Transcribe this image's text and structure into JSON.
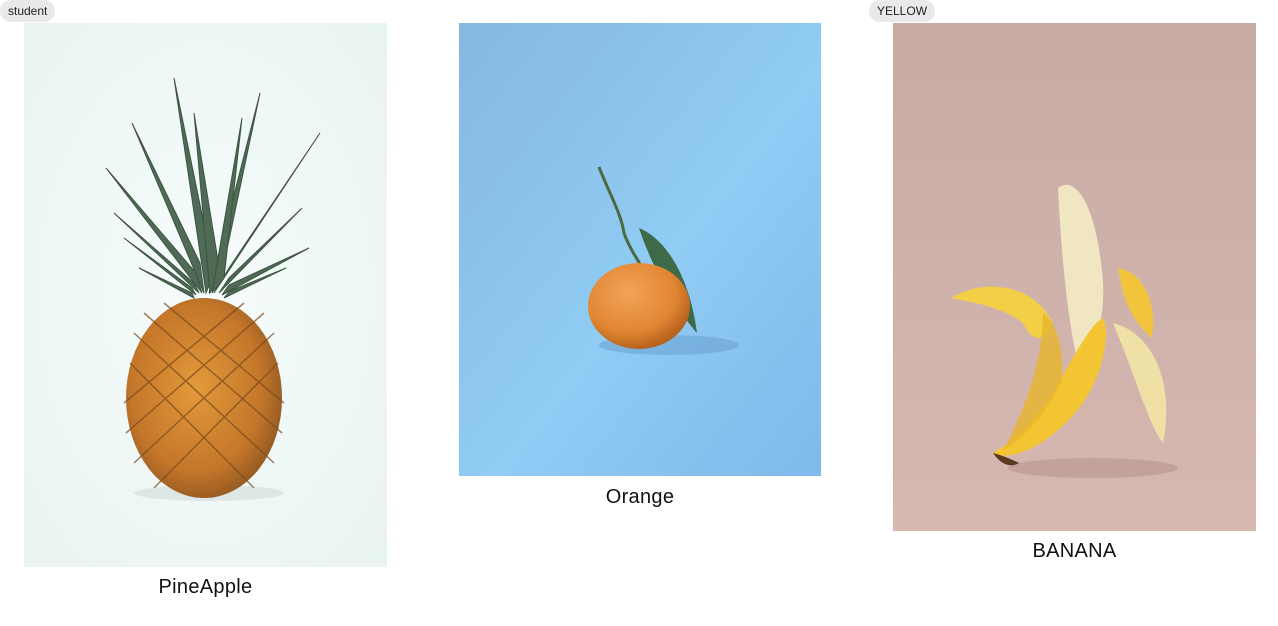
{
  "cards": [
    {
      "tag": "student",
      "caption": "PineApple"
    },
    {
      "tag": "",
      "caption": "Orange"
    },
    {
      "tag": "YELLOW",
      "caption": "BANANA"
    }
  ],
  "colors": {
    "pineapple_bg": "#eef8f6",
    "orange_bg": "#8cc4ee",
    "banana_bg": "#c9aba6",
    "tag_bg": "#e9e9ec"
  }
}
